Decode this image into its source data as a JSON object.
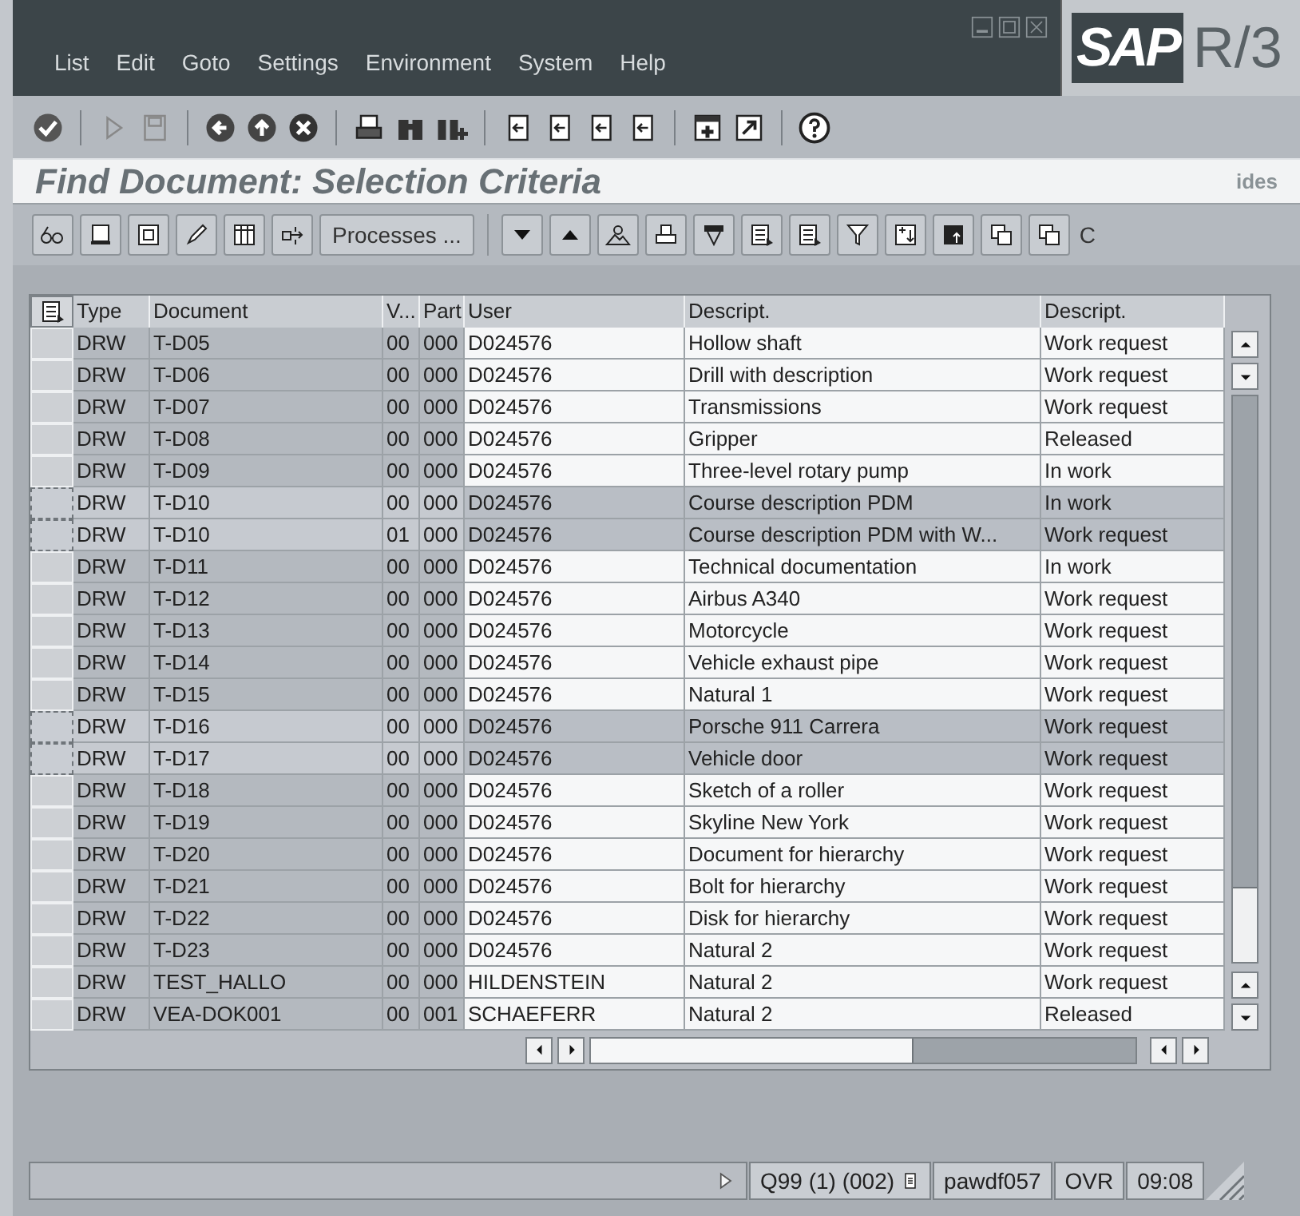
{
  "window": {
    "menu": [
      "List",
      "Edit",
      "Goto",
      "Settings",
      "Environment",
      "System",
      "Help"
    ],
    "logo": {
      "brand": "SAP",
      "release": "R/3"
    }
  },
  "screen_title": "Find Document: Selection Criteria",
  "watermark_logo": "ides",
  "app_toolbar": {
    "processes_button": "Processes ...",
    "cut_button": "C"
  },
  "table": {
    "columns": [
      "Type",
      "Document",
      "V...",
      "Part",
      "User",
      "Descript.",
      "Descript."
    ],
    "rows": [
      {
        "cells": [
          "DRW",
          "T-D05",
          "00",
          "000",
          "D024576",
          "Hollow shaft",
          "Work request"
        ],
        "selected": false
      },
      {
        "cells": [
          "DRW",
          "T-D06",
          "00",
          "000",
          "D024576",
          "Drill with description",
          "Work request"
        ],
        "selected": false
      },
      {
        "cells": [
          "DRW",
          "T-D07",
          "00",
          "000",
          "D024576",
          "Transmissions",
          "Work request"
        ],
        "selected": false
      },
      {
        "cells": [
          "DRW",
          "T-D08",
          "00",
          "000",
          "D024576",
          "Gripper",
          "Released"
        ],
        "selected": false
      },
      {
        "cells": [
          "DRW",
          "T-D09",
          "00",
          "000",
          "D024576",
          "Three-level rotary pump",
          "In work"
        ],
        "selected": false
      },
      {
        "cells": [
          "DRW",
          "T-D10",
          "00",
          "000",
          "D024576",
          "Course description PDM",
          "In work"
        ],
        "selected": true
      },
      {
        "cells": [
          "DRW",
          "T-D10",
          "01",
          "000",
          "D024576",
          "Course description PDM with W...",
          "Work request"
        ],
        "selected": true
      },
      {
        "cells": [
          "DRW",
          "T-D11",
          "00",
          "000",
          "D024576",
          "Technical documentation",
          "In work"
        ],
        "selected": false
      },
      {
        "cells": [
          "DRW",
          "T-D12",
          "00",
          "000",
          "D024576",
          "Airbus A340",
          "Work request"
        ],
        "selected": false
      },
      {
        "cells": [
          "DRW",
          "T-D13",
          "00",
          "000",
          "D024576",
          "Motorcycle",
          "Work request"
        ],
        "selected": false
      },
      {
        "cells": [
          "DRW",
          "T-D14",
          "00",
          "000",
          "D024576",
          "Vehicle exhaust pipe",
          "Work request"
        ],
        "selected": false
      },
      {
        "cells": [
          "DRW",
          "T-D15",
          "00",
          "000",
          "D024576",
          "Natural 1",
          "Work request"
        ],
        "selected": false
      },
      {
        "cells": [
          "DRW",
          "T-D16",
          "00",
          "000",
          "D024576",
          "Porsche 911 Carrera",
          "Work request"
        ],
        "selected": true
      },
      {
        "cells": [
          "DRW",
          "T-D17",
          "00",
          "000",
          "D024576",
          "Vehicle door",
          "Work request"
        ],
        "selected": true
      },
      {
        "cells": [
          "DRW",
          "T-D18",
          "00",
          "000",
          "D024576",
          "Sketch of a roller",
          "Work request"
        ],
        "selected": false
      },
      {
        "cells": [
          "DRW",
          "T-D19",
          "00",
          "000",
          "D024576",
          "Skyline New York",
          "Work request"
        ],
        "selected": false
      },
      {
        "cells": [
          "DRW",
          "T-D20",
          "00",
          "000",
          "D024576",
          "Document for hierarchy",
          "Work request"
        ],
        "selected": false
      },
      {
        "cells": [
          "DRW",
          "T-D21",
          "00",
          "000",
          "D024576",
          "Bolt for hierarchy",
          "Work request"
        ],
        "selected": false
      },
      {
        "cells": [
          "DRW",
          "T-D22",
          "00",
          "000",
          "D024576",
          "Disk for hierarchy",
          "Work request"
        ],
        "selected": false
      },
      {
        "cells": [
          "DRW",
          "T-D23",
          "00",
          "000",
          "D024576",
          "Natural 2",
          "Work request"
        ],
        "selected": false
      },
      {
        "cells": [
          "DRW",
          "TEST_HALLO",
          "00",
          "000",
          "HILDENSTEIN",
          "Natural 2",
          "Work request"
        ],
        "selected": false
      },
      {
        "cells": [
          "DRW",
          "VEA-DOK001",
          "00",
          "001",
          "SCHAEFERR",
          "Natural 2",
          "Released"
        ],
        "selected": false
      }
    ]
  },
  "status_bar": {
    "system": "Q99 (1) (002)",
    "server": "pawdf057",
    "mode": "OVR",
    "time": "09:08"
  }
}
